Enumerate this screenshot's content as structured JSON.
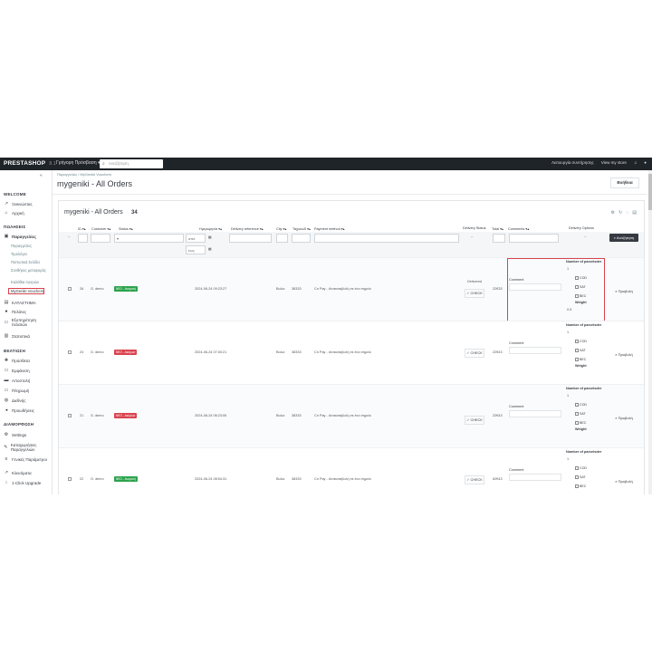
{
  "topbar": {
    "logo": "PRESTASHOP",
    "version": "8.1",
    "quick_access": "Γρήγορη Πρόσβαση ▾",
    "search_placeholder": "Αναζήτηση",
    "right_items": [
      "Λειτουργία συντήρησης",
      "View my store"
    ]
  },
  "sidebar": {
    "collapse": "«",
    "sections": [
      {
        "title": "WELCOME",
        "items": [
          {
            "label": "Ξεκινώντας",
            "icon": "trend-icon"
          },
          {
            "label": "Αρχική",
            "icon": "home-icon"
          }
        ]
      },
      {
        "title": "ΠΩΛΗΣΕΙΣ",
        "items": [
          {
            "label": "Παραγγελίες",
            "icon": "cart-icon"
          }
        ]
      },
      {
        "title": "ΚΑΤΑΣΤΗΜΑ",
        "items": [
          {
            "label": "Πελάτες",
            "icon": "user-icon"
          },
          {
            "label": "Εξυπηρέτηση πελατών",
            "icon": "chat-icon"
          },
          {
            "label": "Στατιστικά",
            "icon": "chart-icon"
          }
        ]
      },
      {
        "title": "ΒΕΛΤΙΩΣΗ",
        "items": [
          {
            "label": "Πρόσθετα",
            "icon": "puzzle-icon"
          },
          {
            "label": "Εμφάνιση",
            "icon": "monitor-icon"
          },
          {
            "label": "Αποστολή",
            "icon": "truck-icon"
          },
          {
            "label": "Πληρωμή",
            "icon": "card-icon"
          },
          {
            "label": "Διεθνής",
            "icon": "globe-icon"
          },
          {
            "label": "Προωθήσεις",
            "icon": "megaphone-icon"
          }
        ]
      },
      {
        "title": "ΔΙΑΜΟΡΦΩΣΗ",
        "items": [
          {
            "label": "Settings",
            "icon": "gear-icon"
          },
          {
            "label": "Καταχωρήσεις Παραγγελιών",
            "icon": "wrench-icon"
          },
          {
            "label": "Γενικές Παράμετροι",
            "icon": "sliders-icon"
          },
          {
            "label": "Κλεισίματα",
            "icon": "trend-icon"
          },
          {
            "label": "1-Click Upgrade",
            "icon": "upgrade-icon"
          }
        ]
      }
    ],
    "orders_sub": [
      "Παραγγελίες",
      "Τιμολόγια",
      "Πιστωτικά Σελίδα",
      "Συνθήκες μεταφοράς",
      "Καλάθια Αγορών",
      "MyGeniki Vouchers"
    ]
  },
  "main": {
    "breadcrumb": "Παραγγελίες  /  MyGeniki Vouchers",
    "title": "mygeniki - All Orders",
    "help_button": "Βοήθεια",
    "card_title": "mygeniki - All Orders",
    "count": "34",
    "columns": [
      "ID ▾▴",
      "Customer ▾▴",
      "Status ▾▴",
      "Ημερομηνία ▾▴",
      "Delivery reference ▾▴",
      "City ▾▴",
      "Ταχυκώδ ▾▴",
      "Payment method ▾▴",
      "Delivery Status",
      "Total ▾▴",
      "Comments ▾▴",
      "Delivery Options"
    ],
    "filter": {
      "dash": "--",
      "date_from": "από",
      "date_to": "έως",
      "search_button": "Αναζήτηση"
    },
    "option_labels": {
      "num": "Number of parcelsder",
      "comment": "Comment",
      "weight": "Weight",
      "cod": "COD",
      "sat": "SAT",
      "bec": "BEC"
    },
    "rows": [
      {
        "id": "26",
        "customer": "G. demo",
        "status": "ΝΕΟ - Αναμονή",
        "status_color": "green",
        "date": "2024-06-24 09:23:27",
        "city": "Βολοι",
        "zip": "38333",
        "payment": "Cn Pay - Αντικαταβολή σε ένα σημείο",
        "check_label": "Delivered",
        "check": "CHECK",
        "total": "22€33",
        "num_value": "1",
        "weight_value": "0.5",
        "view": "Προβολή"
      },
      {
        "id": "24",
        "customer": "G. demo",
        "status": "ΝΕΟ - Ακύρωσ",
        "status_color": "red",
        "date": "2024-06-24 07:00:21",
        "city": "Βολοι",
        "zip": "38333",
        "payment": "Cn Pay - Αντικαταβολή σε ένα σημείο",
        "check_label": "",
        "check": "CHECK",
        "total": "22€43",
        "num_value": "1",
        "weight_value": "",
        "view": "Προβολή"
      },
      {
        "id": "21",
        "customer": "G. demo",
        "status": "ΝΕΟ - Ακύρωσ",
        "status_color": "red",
        "date": "2024-06-24 06:23:06",
        "city": "Βολοι",
        "zip": "38333",
        "payment": "Cn Pay - Αντικαταβολή σε ένα σημείο",
        "check_label": "",
        "check": "CHECK",
        "total": "22€43",
        "num_value": "1",
        "weight_value": "",
        "view": "Προβολή"
      },
      {
        "id": "22",
        "customer": "G. demo",
        "status": "ΝΕΟ - Αναμονή",
        "status_color": "green",
        "date": "2024-06-24 08:54:31",
        "city": "Βολοι",
        "zip": "38333",
        "payment": "Cn Pay - Αντικαταβολή σε ένα σημείο",
        "check_label": "",
        "check": "CHECK",
        "total": "62€43",
        "num_value": "1",
        "weight_value": "",
        "view": "Προβολή"
      }
    ]
  },
  "colors": {
    "accent": "#d9434e",
    "topbar": "#1f2428",
    "green": "#2ca24b"
  }
}
